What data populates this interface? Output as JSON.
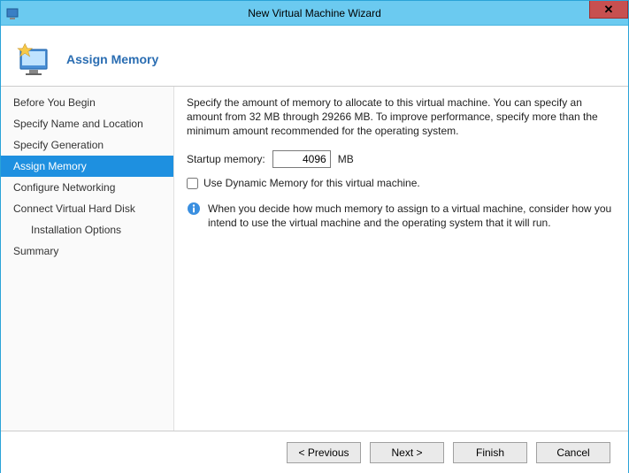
{
  "window": {
    "title": "New Virtual Machine Wizard",
    "close_glyph": "✕"
  },
  "page": {
    "title": "Assign Memory"
  },
  "sidebar": {
    "steps": [
      {
        "label": "Before You Begin",
        "active": false,
        "indent": false
      },
      {
        "label": "Specify Name and Location",
        "active": false,
        "indent": false
      },
      {
        "label": "Specify Generation",
        "active": false,
        "indent": false
      },
      {
        "label": "Assign Memory",
        "active": true,
        "indent": false
      },
      {
        "label": "Configure Networking",
        "active": false,
        "indent": false
      },
      {
        "label": "Connect Virtual Hard Disk",
        "active": false,
        "indent": false
      },
      {
        "label": "Installation Options",
        "active": false,
        "indent": true
      },
      {
        "label": "Summary",
        "active": false,
        "indent": false
      }
    ]
  },
  "content": {
    "description": "Specify the amount of memory to allocate to this virtual machine. You can specify an amount from 32 MB through 29266 MB. To improve performance, specify more than the minimum amount recommended for the operating system.",
    "memory_label": "Startup memory:",
    "memory_value": "4096",
    "memory_unit": "MB",
    "dynamic_label": "Use Dynamic Memory for this virtual machine.",
    "dynamic_checked": false,
    "info_text": "When you decide how much memory to assign to a virtual machine, consider how you intend to use the virtual machine and the operating system that it will run."
  },
  "footer": {
    "previous": "< Previous",
    "next": "Next >",
    "finish": "Finish",
    "cancel": "Cancel"
  }
}
